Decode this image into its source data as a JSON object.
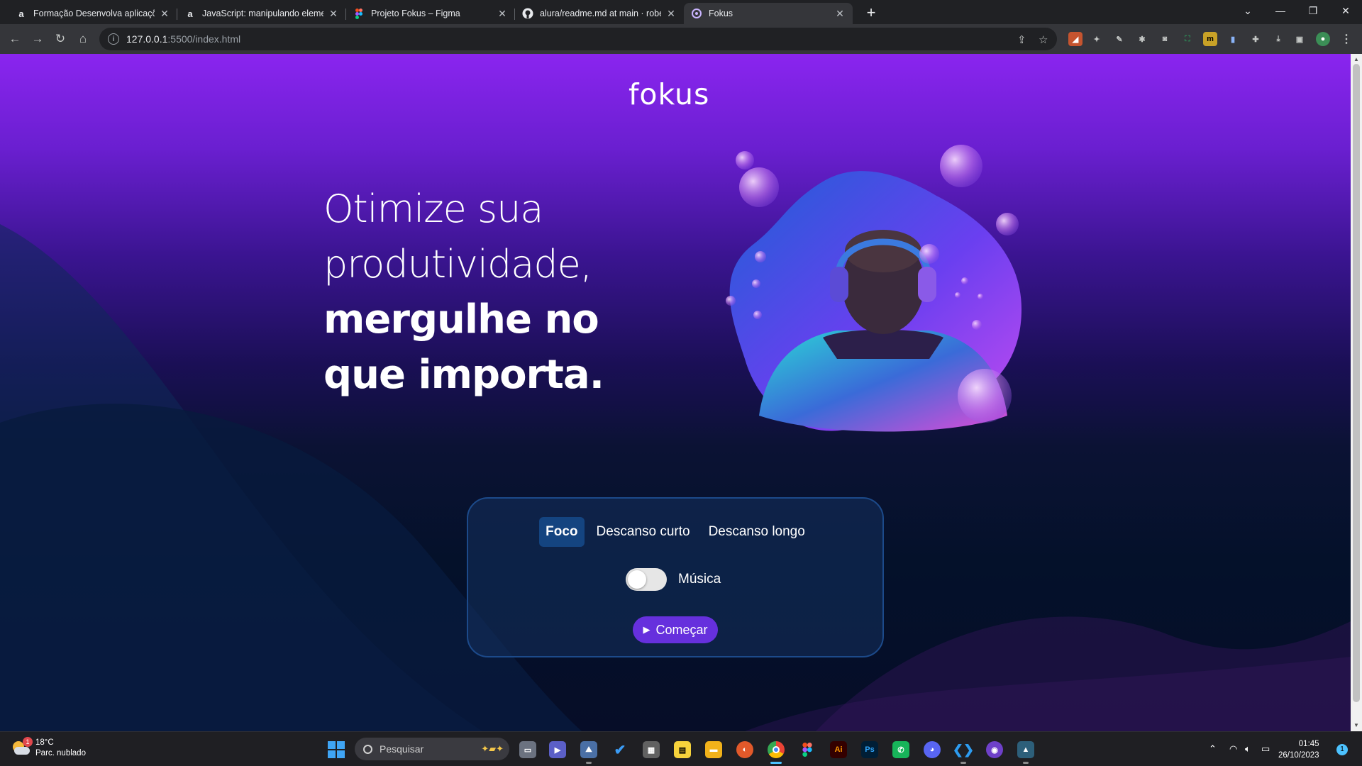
{
  "browser": {
    "tabs": [
      {
        "title": "Formação Desenvolva aplicaçõe",
        "icon": "alura-icon",
        "active": false
      },
      {
        "title": "JavaScript: manipulando elemen",
        "icon": "alura-icon",
        "active": false
      },
      {
        "title": "Projeto Fokus – Figma",
        "icon": "figma-icon",
        "active": false
      },
      {
        "title": "alura/readme.md at main · rober",
        "icon": "github-icon",
        "active": false
      },
      {
        "title": "Fokus",
        "icon": "fokus-icon",
        "active": true
      }
    ],
    "url_host": "127.0.0.1",
    "url_path": ":5500/index.html"
  },
  "page": {
    "logo": "fokus",
    "headline": {
      "light_1": "Otimize sua",
      "light_2": "produtividade,",
      "bold_1": "mergulhe no",
      "bold_2": "que importa."
    },
    "modes": [
      {
        "label": "Foco",
        "active": true
      },
      {
        "label": "Descanso curto",
        "active": false
      },
      {
        "label": "Descanso longo",
        "active": false
      }
    ],
    "music_label": "Música",
    "music_on": false,
    "start_label": "Começar",
    "colors": {
      "accent": "#6630dd",
      "active_mode": "#144480",
      "card_border": "#1c4a8a"
    }
  },
  "taskbar": {
    "weather_temp": "18°C",
    "weather_desc": "Parc. nublado",
    "weather_badge": "1",
    "search_placeholder": "Pesquisar",
    "time": "01:45",
    "date": "26/10/2023",
    "notifications": "1"
  }
}
